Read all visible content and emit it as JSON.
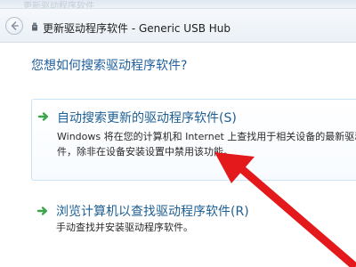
{
  "window": {
    "faded_title": "更新驱动程序软件",
    "title": "更新驱动程序软件 - Generic USB Hub"
  },
  "icons": {
    "back": "back-arrow-icon",
    "device": "usb-device-icon",
    "option_arrow": "green-arrow-icon"
  },
  "main": {
    "question": "您想如何搜索驱动程序软件?",
    "options": [
      {
        "title": "自动搜索更新的驱动程序软件(S)",
        "desc_lines": [
          "Windows 将在您的计算机和 Internet 上查找用于相关设备的最新驱动",
          "件，除非在设备安装设置中禁用该功能。"
        ]
      },
      {
        "title": "浏览计算机以查找驱动程序软件(R)",
        "desc_lines": [
          "手动查找并安装驱动程序软件。"
        ]
      }
    ]
  },
  "colors": {
    "heading_blue": "#1f5f9f",
    "option_blue": "#1e5f93",
    "arrow_green": "#3aa54a",
    "annotation_red": "#e3191c",
    "selected_border": "#c9e3f7"
  }
}
